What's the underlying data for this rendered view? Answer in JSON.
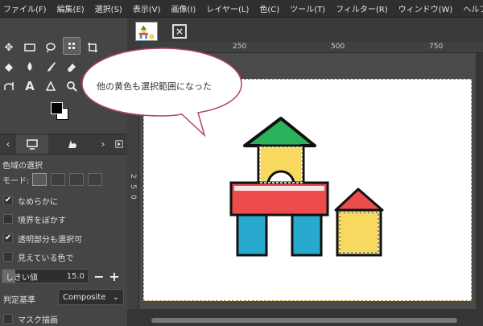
{
  "menubar": {
    "items": [
      "ファイル(F)",
      "編集(E)",
      "選択(S)",
      "表示(V)",
      "画像(I)",
      "レイヤー(L)",
      "色(C)",
      "ツール(T)",
      "フィルター(R)",
      "ウィンドウ(W)",
      "ヘルプ(H)"
    ]
  },
  "toolbox": {
    "tool_icons": [
      "move-icon",
      "rect-select-icon",
      "lasso-icon",
      "fuzzy-select-icon",
      "crop-icon",
      "fill-icon",
      "paintbrush-icon",
      "eraser-icon",
      "paths-icon",
      "text-icon",
      "smudge-icon",
      "zoom-icon"
    ],
    "text_tool_glyph": "A"
  },
  "colors": {
    "foreground": "#000000",
    "background": "#ffffff"
  },
  "tool_options": {
    "title": "色域の選択",
    "mode_label": "モード:",
    "antialias_label": "なめらかに",
    "antialias_checked": true,
    "feather_label": "境界をぼかす",
    "feather_checked": false,
    "transparent_label": "透明部分も選択可",
    "transparent_checked": true,
    "sample_merged_label": "見えている色で",
    "sample_merged_checked": false,
    "threshold_label": "しきい値",
    "threshold_value": "15.0",
    "threshold_fraction": 0.15,
    "criterion_label": "判定基準",
    "criterion_value": "Composite",
    "draw_mask_label": "マスク描画",
    "draw_mask_checked": false
  },
  "ruler": {
    "top_labels": [
      "250",
      "500",
      "750"
    ],
    "left_labels": [
      "2",
      "5",
      "0"
    ]
  },
  "annotation": {
    "callout_text": "他の黄色も選択範囲になった"
  }
}
